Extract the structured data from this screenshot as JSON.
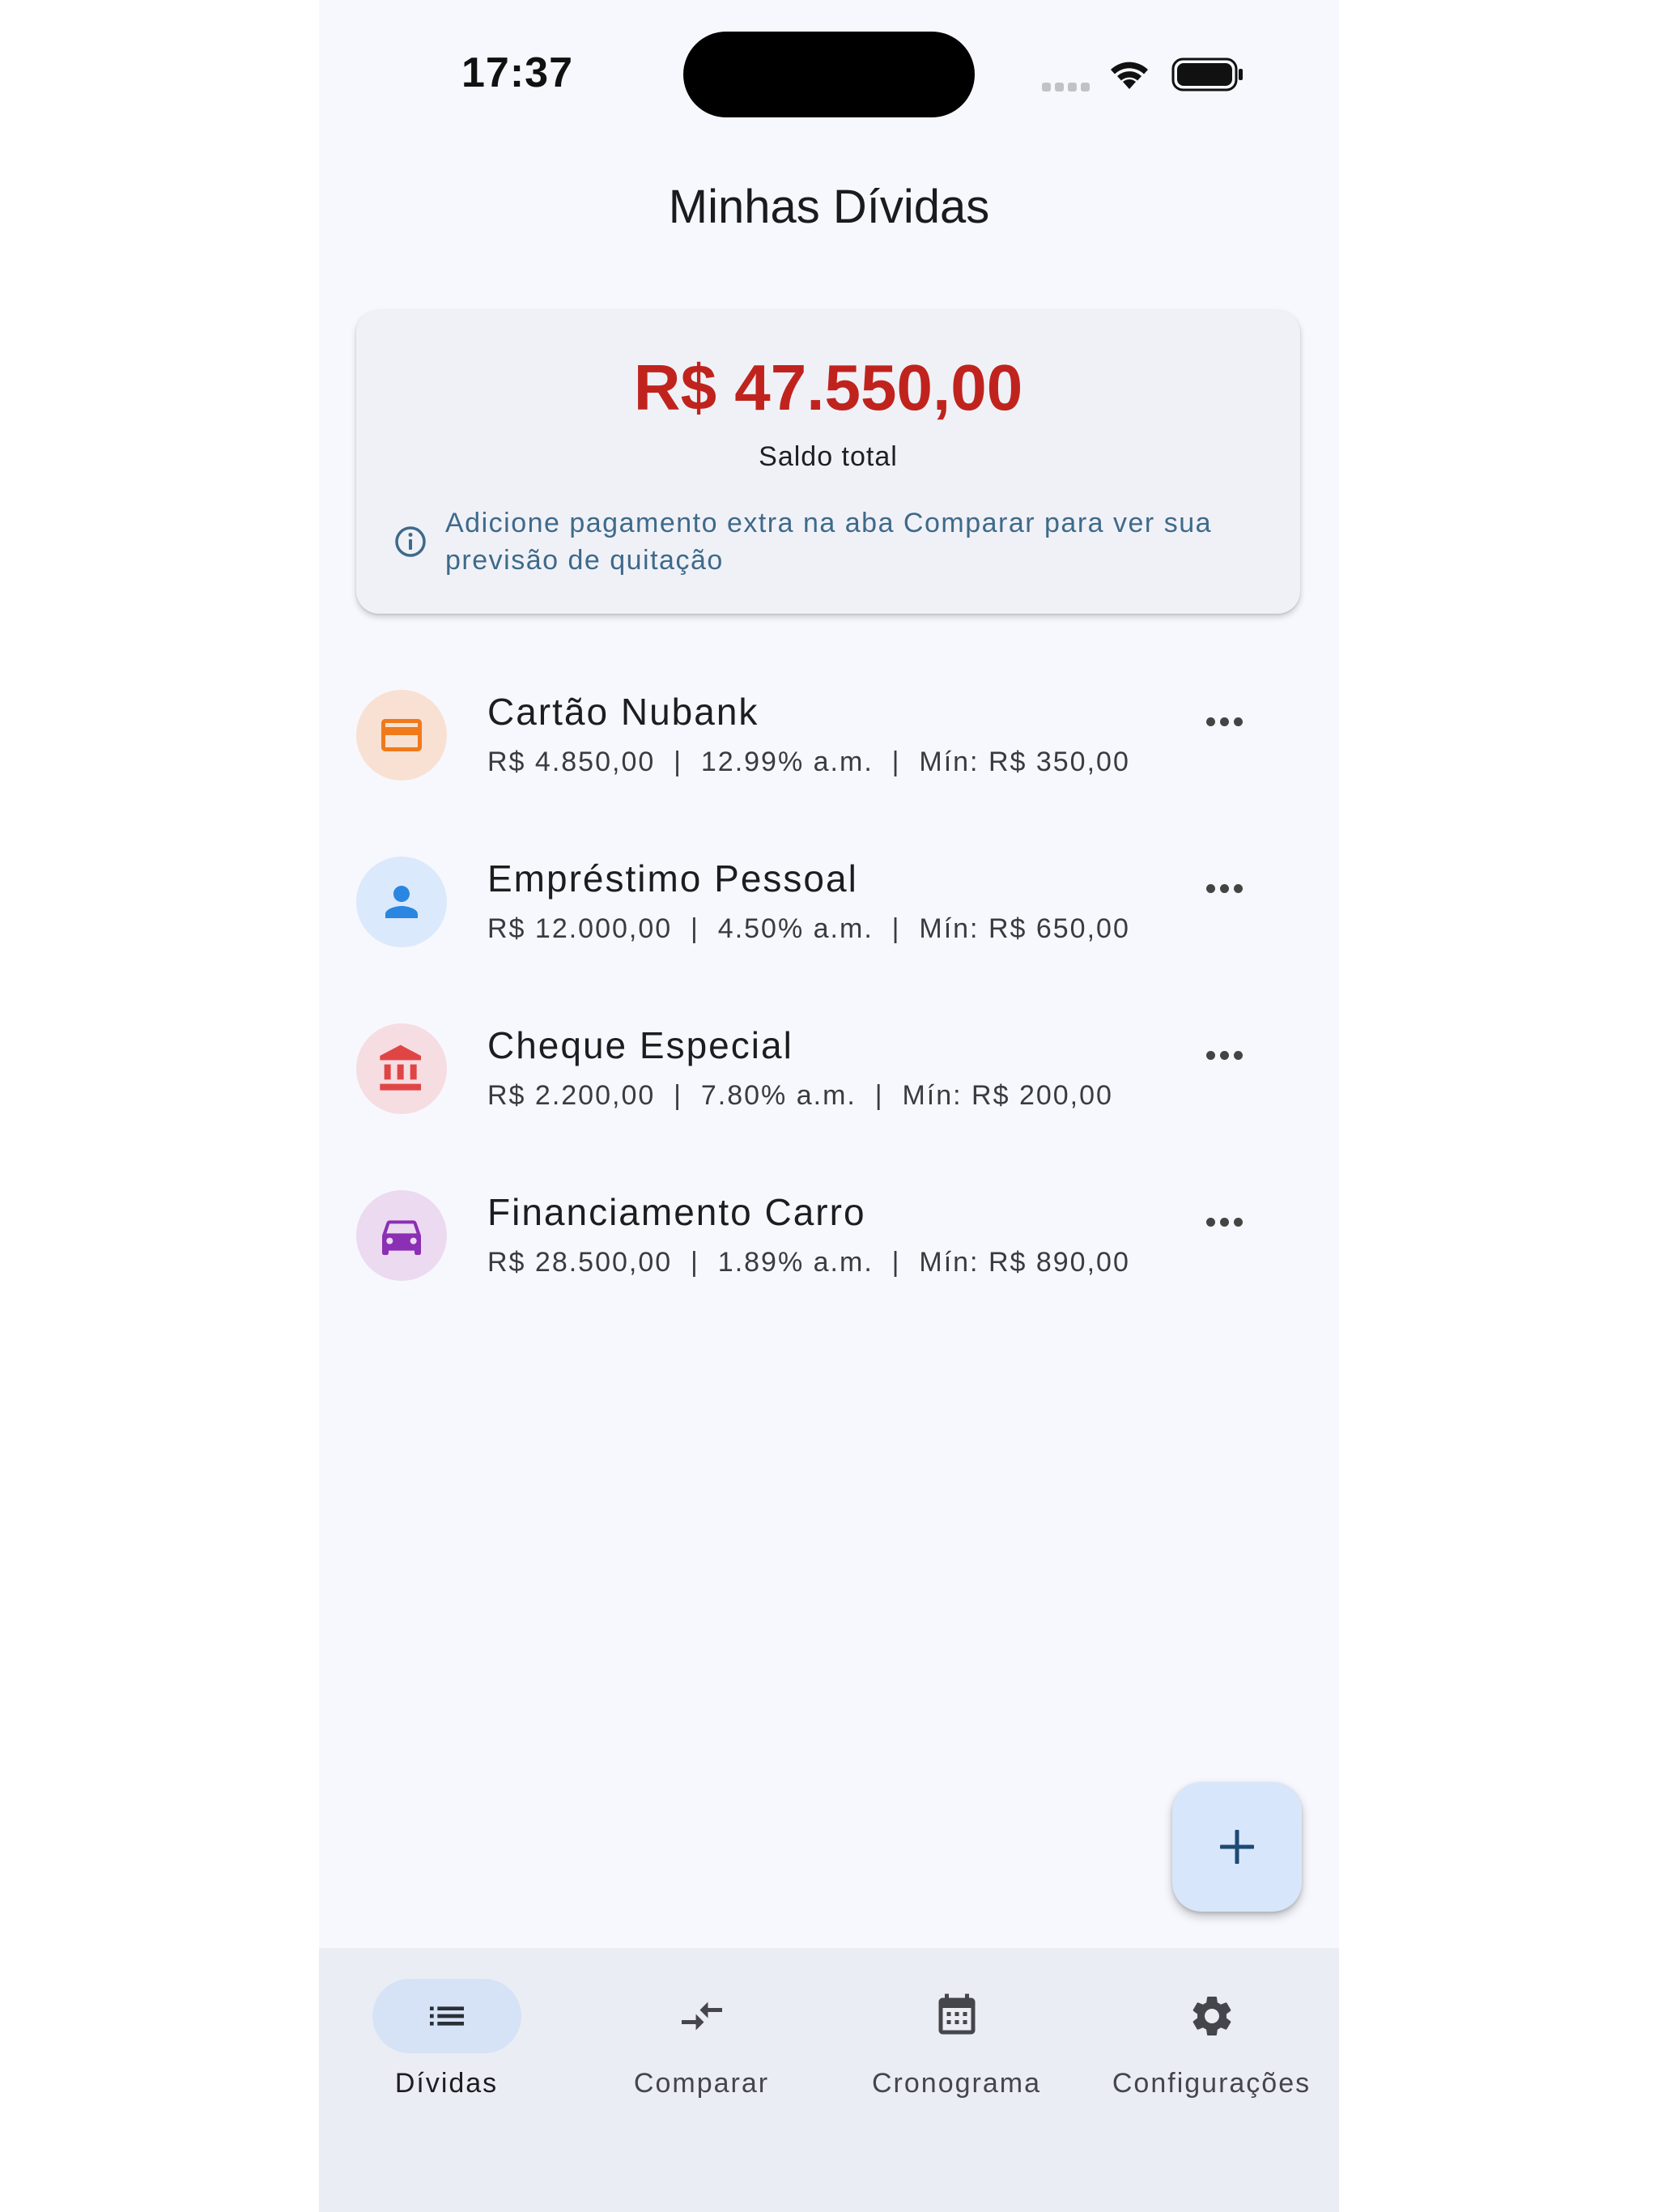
{
  "status_bar": {
    "time": "17:37"
  },
  "header": {
    "title": "Minhas Dívidas"
  },
  "summary": {
    "total_amount": "R$ 47.550,00",
    "total_label": "Saldo total",
    "info_text": "Adicione pagamento extra na aba Comparar para ver sua previsão de quitação"
  },
  "debts": [
    {
      "name": "Cartão Nubank",
      "details": "R$ 4.850,00  |  12.99% a.m.  |  Mín: R$ 350,00",
      "icon": "credit-card-icon",
      "color": "#f07a1a",
      "bg": "#f8e1d3"
    },
    {
      "name": "Empréstimo Pessoal",
      "details": "R$ 12.000,00  |  4.50% a.m.  |  Mín: R$ 650,00",
      "icon": "person-icon",
      "color": "#2a86e0",
      "bg": "#dae9fb"
    },
    {
      "name": "Cheque Especial",
      "details": "R$ 2.200,00  |  7.80% a.m.  |  Mín: R$ 200,00",
      "icon": "bank-icon",
      "color": "#e04545",
      "bg": "#f6dde2"
    },
    {
      "name": "Financiamento Carro",
      "details": "R$ 28.500,00  |  1.89% a.m.  |  Mín: R$ 890,00",
      "icon": "car-icon",
      "color": "#8b2fb4",
      "bg": "#ebdaf0"
    }
  ],
  "fab": {
    "icon": "plus-icon"
  },
  "bottom_nav": [
    {
      "label": "Dívidas",
      "icon": "list-icon",
      "active": true
    },
    {
      "label": "Comparar",
      "icon": "compare-arrows-icon",
      "active": false
    },
    {
      "label": "Cronograma",
      "icon": "calendar-icon",
      "active": false
    },
    {
      "label": "Configurações",
      "icon": "gear-icon",
      "active": false
    }
  ],
  "colors": {
    "background": "#f7f8fd",
    "total_amount": "#c0231d",
    "info_text": "#3e6a8a",
    "nav_active_pill": "#d6e3f6",
    "fab": "#d8e6fb"
  }
}
